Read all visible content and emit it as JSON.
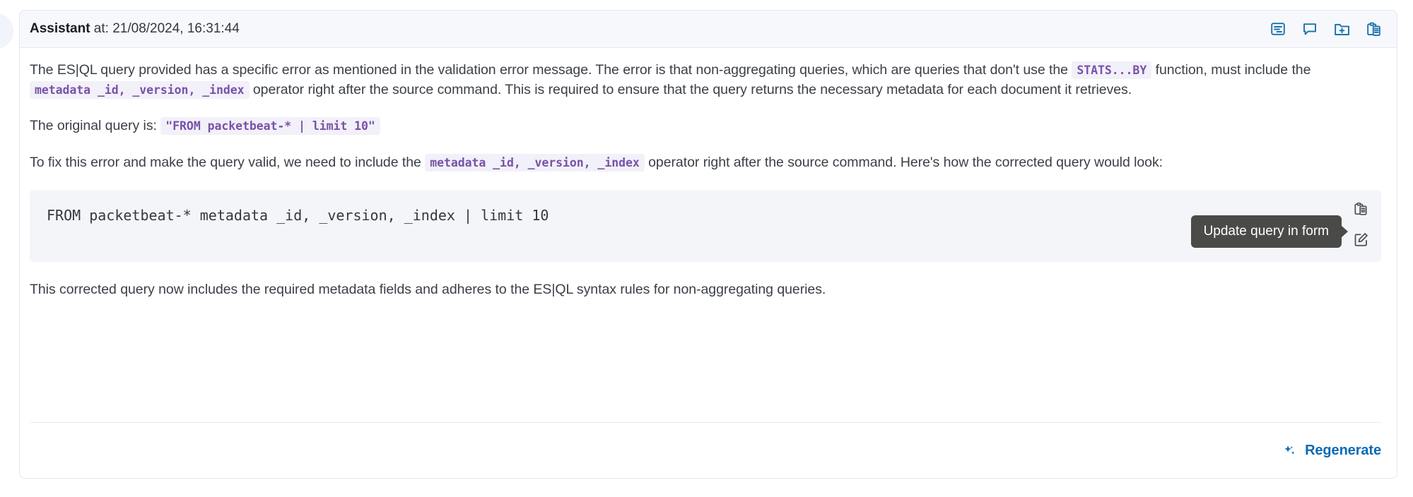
{
  "avatar": {
    "present": true
  },
  "header": {
    "role": "Assistant",
    "timestamp_prefix": " at: ",
    "timestamp": "21/08/2024, 16:31:44",
    "accent_color": "#1a73ab",
    "actions": [
      {
        "name": "view-document-icon",
        "label": "Document"
      },
      {
        "name": "comment-icon",
        "label": "Comment"
      },
      {
        "name": "folder-plus-icon",
        "label": "Add to folder"
      },
      {
        "name": "clipboard-copy-icon",
        "label": "Copy"
      }
    ]
  },
  "body": {
    "paragraph1": {
      "part1": "The ES|QL query provided has a specific error as mentioned in the validation error message. The error is that non-aggregating queries, which are queries that don't use the ",
      "code1": "STATS...BY",
      "part2": " function, must include the ",
      "code2": "metadata _id, _version, _index",
      "part3": " operator right after the source command. This is required to ensure that the query returns the necessary metadata for each document it retrieves."
    },
    "paragraph2": {
      "part1": "The original query is: ",
      "code1": "\"FROM packetbeat-* | limit 10\""
    },
    "paragraph3": {
      "part1": "To fix this error and make the query valid, we need to include the ",
      "code1": "metadata _id, _version, _index",
      "part2": " operator right after the source command. Here's how the corrected query would look:"
    },
    "codeblock": {
      "content": "FROM packetbeat-* metadata _id, _version, _index | limit 10",
      "background": "#f4f5f9",
      "actions": [
        {
          "name": "copy-code-icon",
          "label": "Copy"
        },
        {
          "name": "update-query-icon",
          "label": "Update query in form"
        }
      ],
      "tooltip": "Update query in form",
      "tooltip_color": "#4a4a48"
    },
    "paragraph4": {
      "part1": "This corrected query now includes the required metadata fields and adheres to the ES|QL syntax rules for non-aggregating queries."
    }
  },
  "footer": {
    "regenerate_label": "Regenerate",
    "regenerate_icon": "sparkles-icon",
    "link_color": "#0b6ab4"
  }
}
